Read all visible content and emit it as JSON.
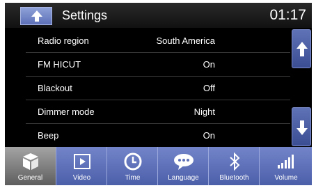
{
  "header": {
    "title": "Settings",
    "time": "01:17",
    "home_icon": "home-icon"
  },
  "settings": {
    "rows": [
      {
        "label": "Radio region",
        "value": "South America"
      },
      {
        "label": "FM HICUT",
        "value": "On"
      },
      {
        "label": "Blackout",
        "value": "Off"
      },
      {
        "label": "Dimmer mode",
        "value": "Night"
      },
      {
        "label": "Beep",
        "value": "On"
      }
    ]
  },
  "scroll": {
    "up_icon": "arrow-up-icon",
    "down_icon": "arrow-down-icon"
  },
  "tabs": [
    {
      "label": "General",
      "icon": "cube-icon",
      "active": true
    },
    {
      "label": "Video",
      "icon": "play-icon",
      "active": false
    },
    {
      "label": "Time",
      "icon": "clock-icon",
      "active": false
    },
    {
      "label": "Language",
      "icon": "speech-bubble-icon",
      "active": false
    },
    {
      "label": "Bluetooth",
      "icon": "bluetooth-icon",
      "active": false
    },
    {
      "label": "Volume",
      "icon": "volume-bars-icon",
      "active": false
    }
  ],
  "colors": {
    "accent": "#5d70b8",
    "background": "#000000",
    "active_tab": "#8a8a8a"
  }
}
